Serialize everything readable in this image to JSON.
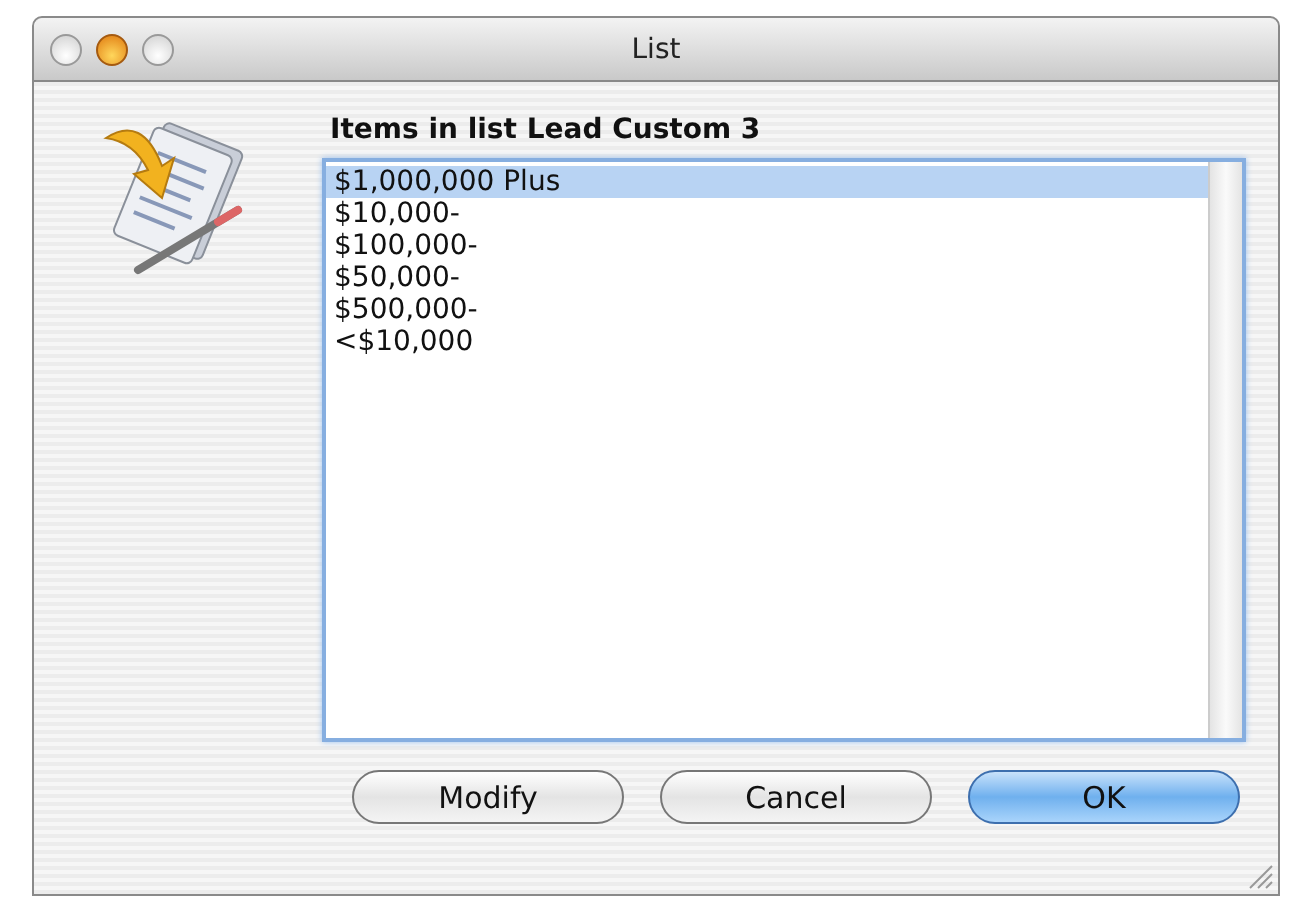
{
  "window": {
    "title": "List"
  },
  "label": "Items in list Lead Custom 3",
  "list": {
    "items": [
      {
        "text": "$1,000,000 Plus",
        "selected": true
      },
      {
        "text": "$10,000-",
        "selected": false
      },
      {
        "text": "$100,000-",
        "selected": false
      },
      {
        "text": "$50,000-",
        "selected": false
      },
      {
        "text": "$500,000-",
        "selected": false
      },
      {
        "text": "<$10,000",
        "selected": false
      }
    ]
  },
  "buttons": [
    {
      "label": "Modify",
      "kind": "normal"
    },
    {
      "label": "Cancel",
      "kind": "normal"
    },
    {
      "label": "OK",
      "kind": "default"
    }
  ]
}
